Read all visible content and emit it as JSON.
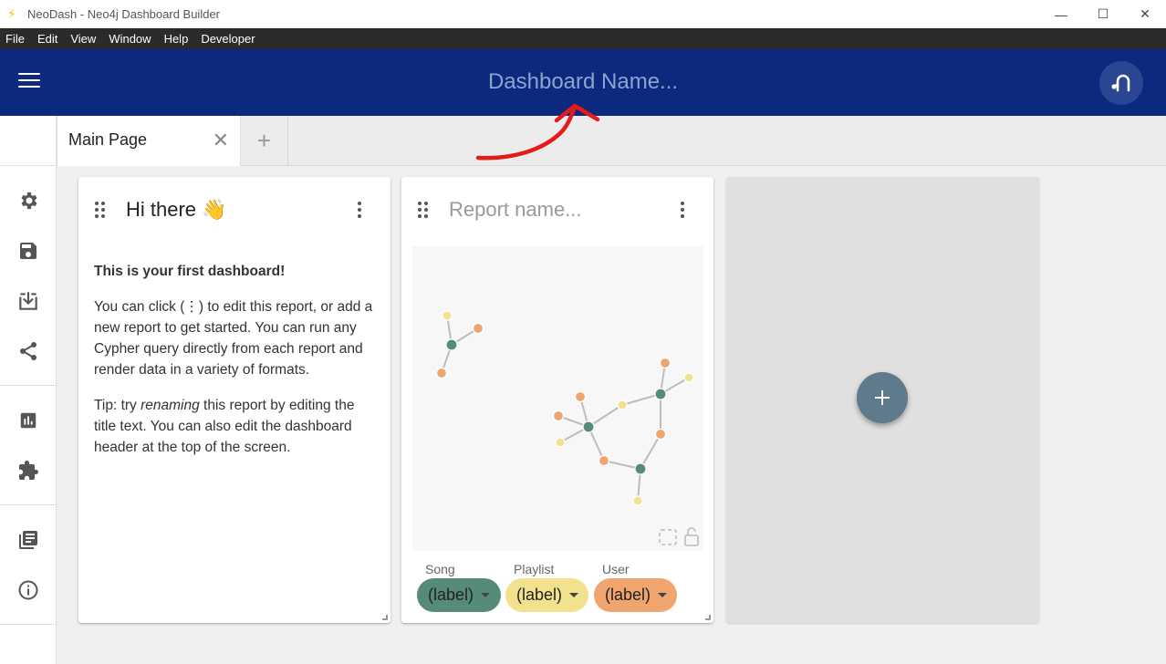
{
  "window": {
    "title": "NeoDash - Neo4j Dashboard Builder",
    "controls": [
      "—",
      "☐",
      "✕"
    ]
  },
  "menu": [
    "File",
    "Edit",
    "View",
    "Window",
    "Help",
    "Developer"
  ],
  "header": {
    "dashboard_name_placeholder": "Dashboard Name..."
  },
  "tabs": {
    "items": [
      {
        "label": "Main Page",
        "close": "✕"
      }
    ],
    "add_label": "+"
  },
  "sidebar": {
    "icons": [
      "gear-icon",
      "save-icon",
      "load-icon",
      "share-icon",
      "chart-icon",
      "extension-icon",
      "docs-icon",
      "info-icon"
    ]
  },
  "cards": [
    {
      "title": "Hi there 👋",
      "body": {
        "heading": "This is your first dashboard!",
        "p1": "You can click (⋮) to edit this report, or add a new report to get started. You can run any Cypher query directly from each report and render data in a variety of formats.",
        "p2_pre": "Tip: try ",
        "p2_em": "renaming",
        "p2_post": " this report by editing the title text. You can also edit the dashboard header at the top of the screen."
      }
    },
    {
      "title_placeholder": "Report name...",
      "legend": [
        {
          "name": "Song",
          "chip": "(label)",
          "color": "#568a79"
        },
        {
          "name": "Playlist",
          "chip": "(label)",
          "color": "#f2e28e"
        },
        {
          "name": "User",
          "chip": "(label)",
          "color": "#efa56d"
        }
      ]
    }
  ],
  "add_report": {
    "label": "+"
  },
  "colors": {
    "header": "#0b2a7e",
    "song": "#568a79",
    "playlist": "#f2e28e",
    "user": "#efa56d",
    "fab": "#5f7a8a"
  }
}
